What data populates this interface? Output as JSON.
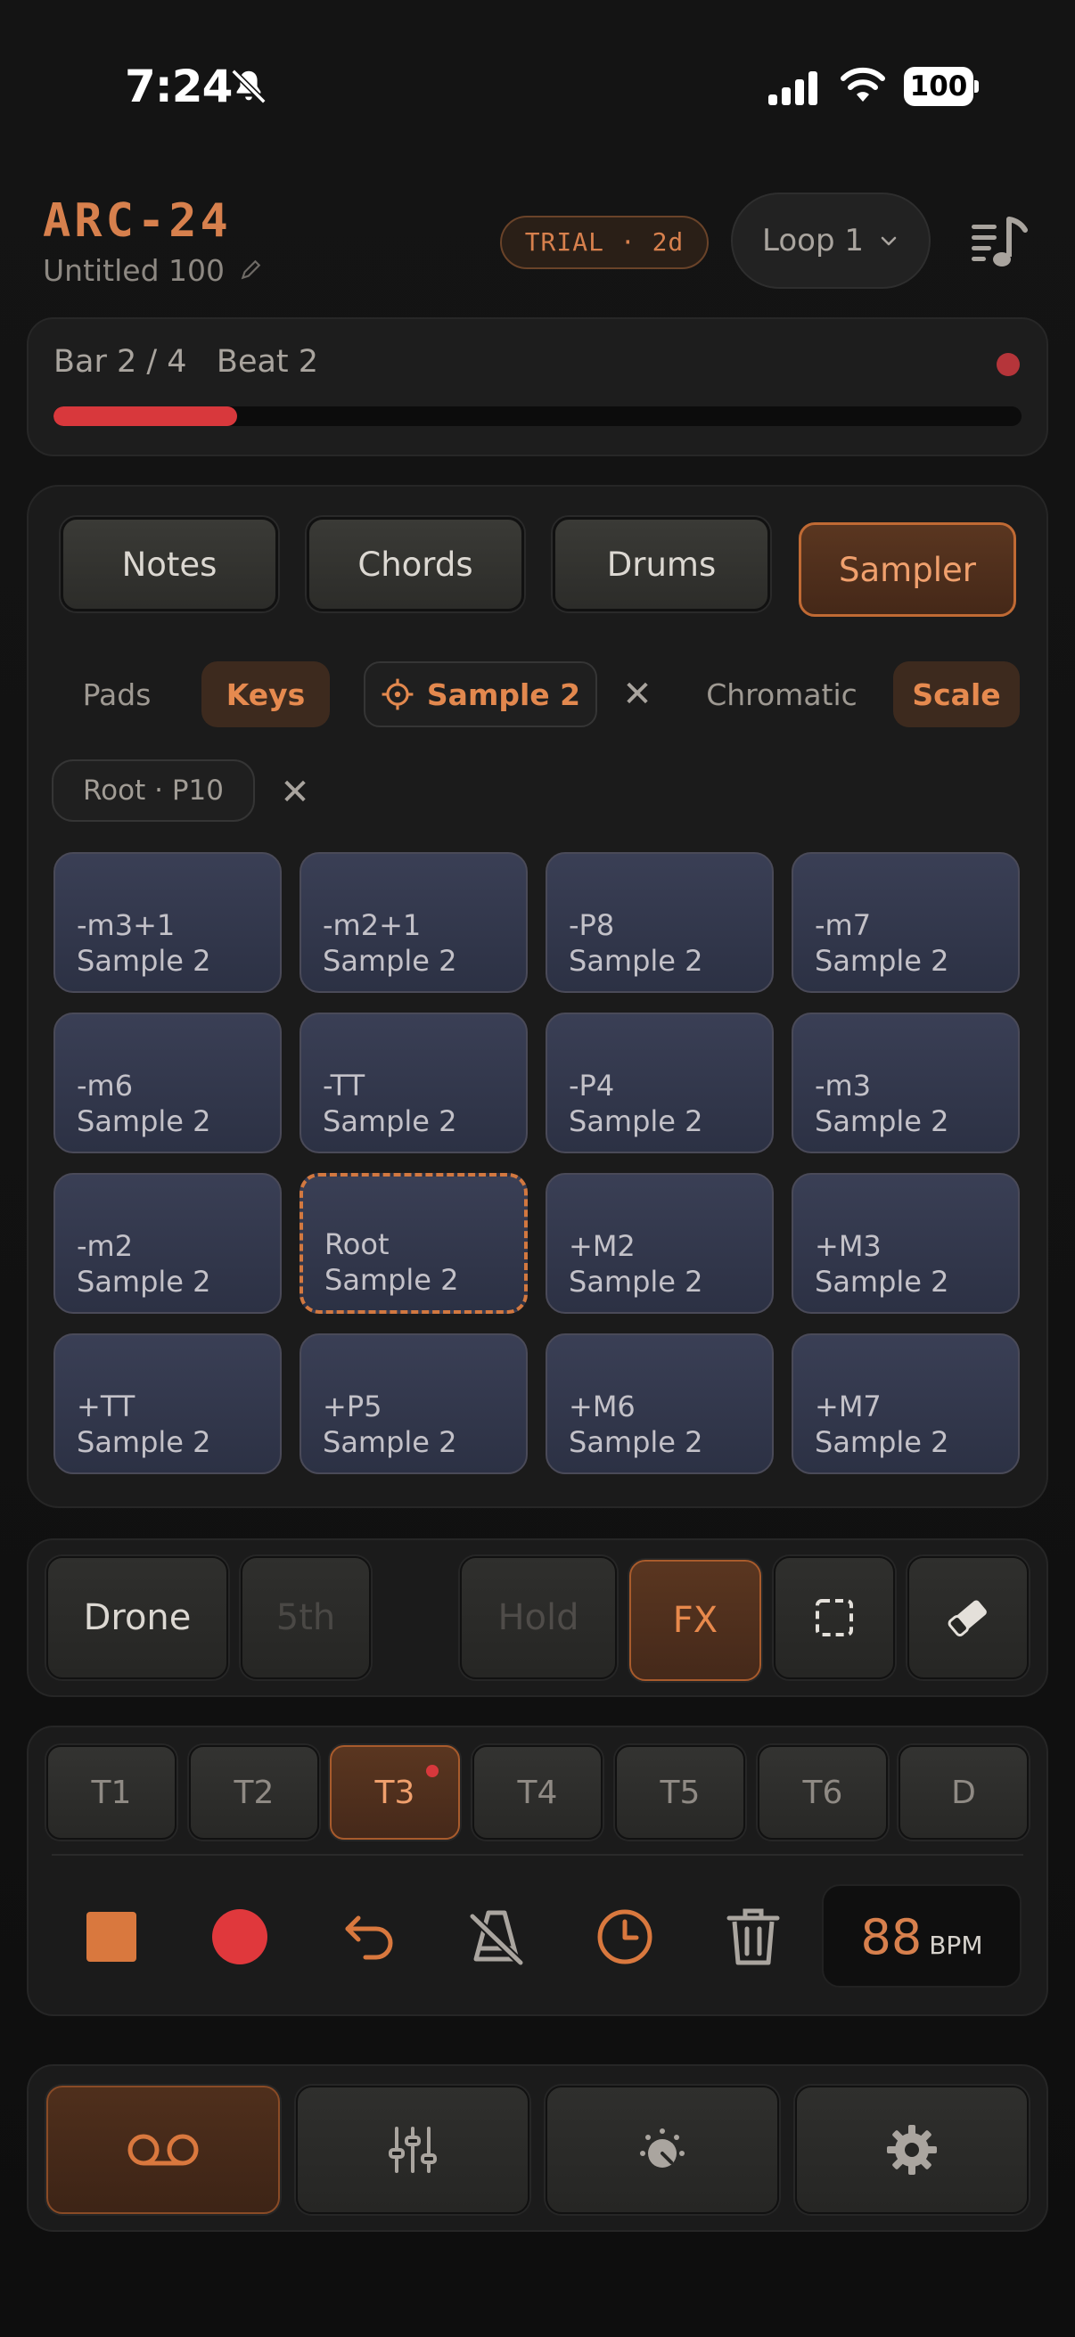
{
  "status_bar": {
    "time": "7:24",
    "battery": "100"
  },
  "header": {
    "app_title": "ARC-24",
    "project_name": "Untitled 100",
    "trial_badge": "TRIAL · 2d",
    "loop_selector": "Loop 1"
  },
  "transport_position": {
    "bar_beat": "Bar 2 / 4   Beat 2",
    "progress": 0.19
  },
  "modes": [
    "Notes",
    "Chords",
    "Drums",
    "Sampler"
  ],
  "active_mode": "Sampler",
  "layout_toggle": {
    "pads": "Pads",
    "keys": "Keys",
    "active": "Keys"
  },
  "sample_chip": "Sample 2",
  "scale_toggle": {
    "chromatic": "Chromatic",
    "scale": "Scale",
    "active": "Scale"
  },
  "root_chip": "Root · P10",
  "pads": [
    {
      "interval": "-m3+1",
      "sample": "Sample 2"
    },
    {
      "interval": "-m2+1",
      "sample": "Sample 2"
    },
    {
      "interval": "-P8",
      "sample": "Sample 2"
    },
    {
      "interval": "-m7",
      "sample": "Sample 2"
    },
    {
      "interval": "-m6",
      "sample": "Sample 2"
    },
    {
      "interval": "-TT",
      "sample": "Sample 2"
    },
    {
      "interval": "-P4",
      "sample": "Sample 2"
    },
    {
      "interval": "-m3",
      "sample": "Sample 2"
    },
    {
      "interval": "-m2",
      "sample": "Sample 2"
    },
    {
      "interval": "Root",
      "sample": "Sample 2"
    },
    {
      "interval": "+M2",
      "sample": "Sample 2"
    },
    {
      "interval": "+M3",
      "sample": "Sample 2"
    },
    {
      "interval": "+TT",
      "sample": "Sample 2"
    },
    {
      "interval": "+P5",
      "sample": "Sample 2"
    },
    {
      "interval": "+M6",
      "sample": "Sample 2"
    },
    {
      "interval": "+M7",
      "sample": "Sample 2"
    }
  ],
  "controls": {
    "drone": "Drone",
    "fifth": "5th",
    "hold": "Hold",
    "fx": "FX"
  },
  "tracks": [
    "T1",
    "T2",
    "T3",
    "T4",
    "T5",
    "T6",
    "D"
  ],
  "active_track": "T3",
  "tempo": {
    "value": "88",
    "unit": "BPM"
  },
  "colors": {
    "accent": "#d7804d",
    "record": "#d8383c",
    "pad": "#33384c",
    "background": "#141414"
  }
}
